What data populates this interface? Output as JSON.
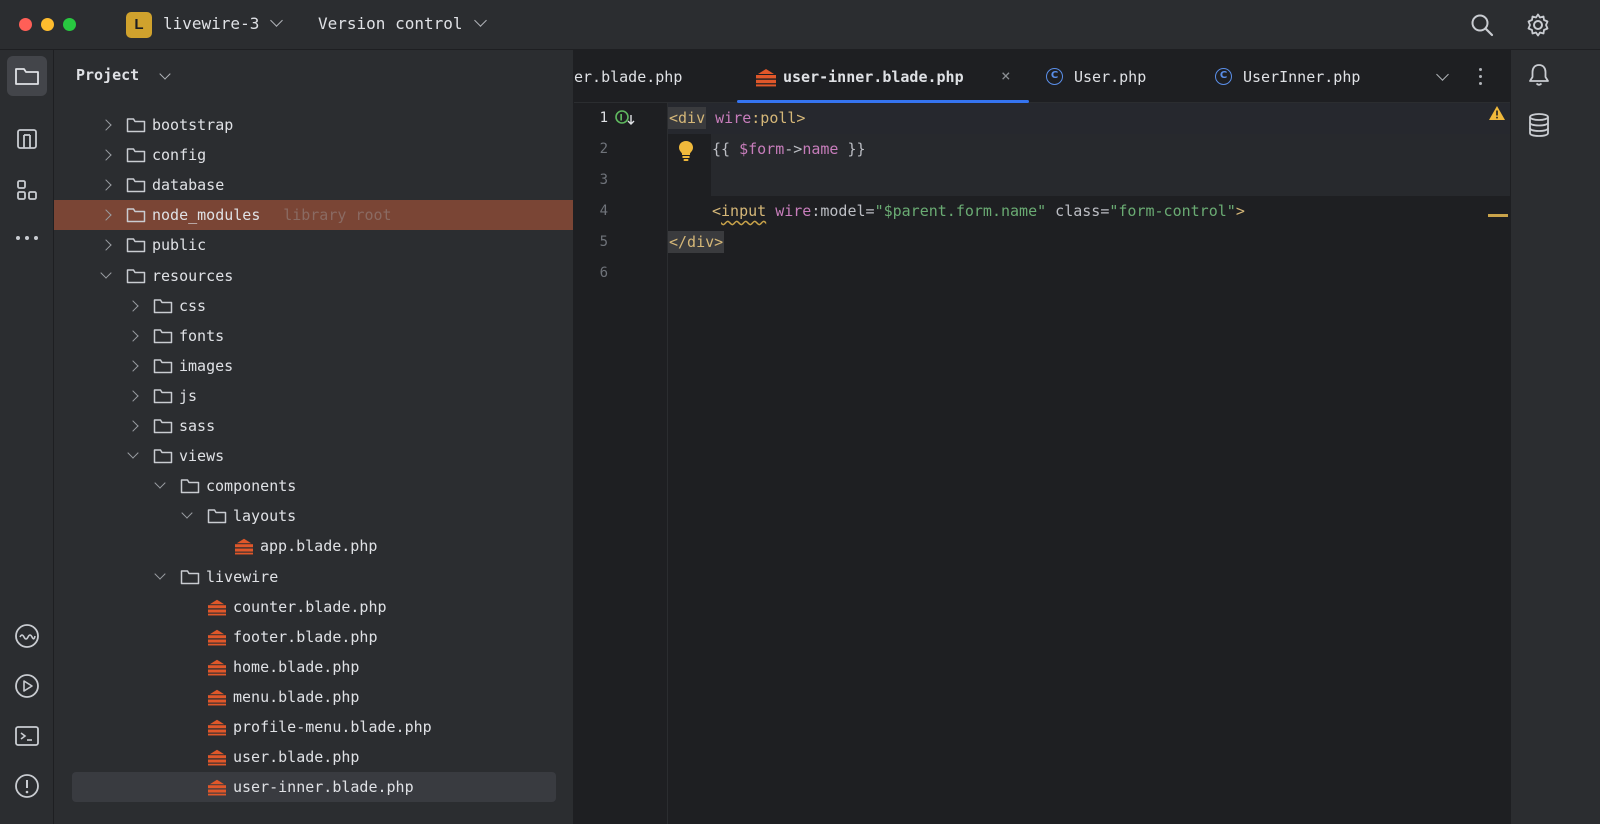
{
  "titlebar": {
    "project_initial": "L",
    "project_name": "livewire-3",
    "vcs_label": "Version control"
  },
  "project_panel": {
    "title": "Project",
    "tree": [
      {
        "label": "bootstrap",
        "kind": "folder",
        "depth": 0,
        "expanded": false
      },
      {
        "label": "config",
        "kind": "folder",
        "depth": 0,
        "expanded": false
      },
      {
        "label": "database",
        "kind": "folder",
        "depth": 0,
        "expanded": false
      },
      {
        "label": "node_modules",
        "kind": "folder",
        "depth": 0,
        "expanded": false,
        "hint": "library root",
        "highlight": true
      },
      {
        "label": "public",
        "kind": "folder",
        "depth": 0,
        "expanded": false
      },
      {
        "label": "resources",
        "kind": "folder",
        "depth": 0,
        "expanded": true
      },
      {
        "label": "css",
        "kind": "folder",
        "depth": 1,
        "expanded": false
      },
      {
        "label": "fonts",
        "kind": "folder",
        "depth": 1,
        "expanded": false
      },
      {
        "label": "images",
        "kind": "folder",
        "depth": 1,
        "expanded": false
      },
      {
        "label": "js",
        "kind": "folder",
        "depth": 1,
        "expanded": false
      },
      {
        "label": "sass",
        "kind": "folder",
        "depth": 1,
        "expanded": false
      },
      {
        "label": "views",
        "kind": "folder",
        "depth": 1,
        "expanded": true
      },
      {
        "label": "components",
        "kind": "folder",
        "depth": 2,
        "expanded": true
      },
      {
        "label": "layouts",
        "kind": "folder",
        "depth": 3,
        "expanded": true
      },
      {
        "label": "app.blade.php",
        "kind": "blade",
        "depth": 4
      },
      {
        "label": "livewire",
        "kind": "folder",
        "depth": 2,
        "expanded": true
      },
      {
        "label": "counter.blade.php",
        "kind": "blade",
        "depth": 3
      },
      {
        "label": "footer.blade.php",
        "kind": "blade",
        "depth": 3
      },
      {
        "label": "home.blade.php",
        "kind": "blade",
        "depth": 3
      },
      {
        "label": "menu.blade.php",
        "kind": "blade",
        "depth": 3
      },
      {
        "label": "profile-menu.blade.php",
        "kind": "blade",
        "depth": 3
      },
      {
        "label": "user.blade.php",
        "kind": "blade",
        "depth": 3
      },
      {
        "label": "user-inner.blade.php",
        "kind": "blade",
        "depth": 3,
        "selected": true
      }
    ]
  },
  "tabs": [
    {
      "label": "er.blade.php",
      "icon": "none"
    },
    {
      "label": "user-inner.blade.php",
      "icon": "blade-icon",
      "active": true
    },
    {
      "label": "User.php",
      "icon": "class-icon",
      "icon_letter": "C"
    },
    {
      "label": "UserInner.php",
      "icon": "class-icon",
      "icon_letter": "C"
    }
  ],
  "tab_close": "×",
  "editor": {
    "line_numbers": [
      "1",
      "2",
      "3",
      "4",
      "5",
      "6"
    ],
    "lines": {
      "l1_tag": "<div",
      "l1_attr": "wire",
      "l1_rest": ":poll>",
      "l2_open": "{{ ",
      "l2_var": "$form",
      "l2_arrow": "->",
      "l2_prop": "name",
      "l2_close": " }}",
      "l4_lt": "<",
      "l4_tag": "input",
      "l4_attr1": "wire",
      "l4_attr1_rest": ":model=",
      "l4_str1": "\"$parent.form.name\"",
      "l4_attr2": " class=",
      "l4_str2": "\"form-control\"",
      "l4_gt": ">",
      "l5_tag": "</div>"
    }
  },
  "colors": {
    "accent": "#3574f0",
    "highlight_row": "#7a4535",
    "blade_icon": "#e0572a",
    "warning": "#f0b93b"
  }
}
